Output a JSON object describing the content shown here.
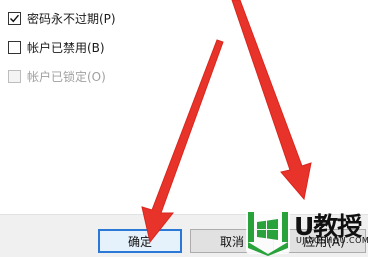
{
  "options": [
    {
      "label": "密码永不过期(P)",
      "checked": true,
      "disabled": false
    },
    {
      "label": "帐户已禁用(B)",
      "checked": false,
      "disabled": false
    },
    {
      "label": "帐户已锁定(O)",
      "checked": false,
      "disabled": true
    }
  ],
  "buttons": {
    "ok": "确定",
    "cancel": "取消",
    "apply": "应用(A)"
  },
  "watermark": {
    "brand": "U教授",
    "url": "UJIAOSHOU.COM"
  },
  "colors": {
    "arrow": "#e8332a",
    "logo_green": "#2aa23c",
    "ok_border": "#2b78d6"
  }
}
